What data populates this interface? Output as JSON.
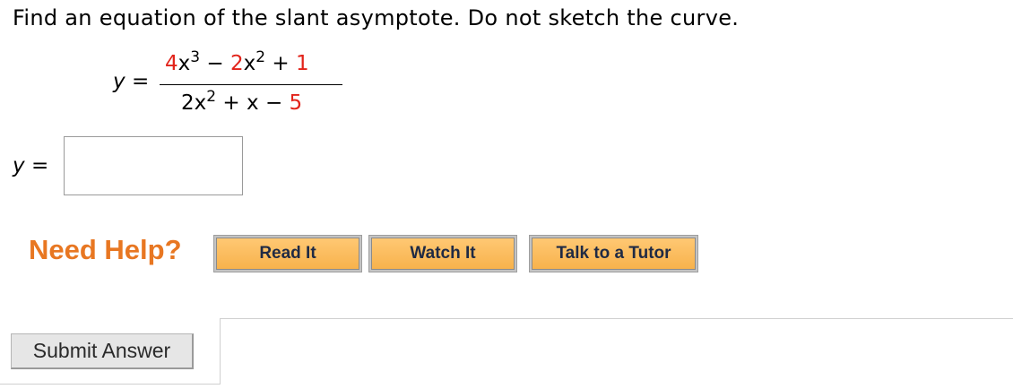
{
  "question": {
    "text": "Find an equation of the slant asymptote. Do not sketch the curve."
  },
  "equation": {
    "lhs_var": "y",
    "equals": "=",
    "numerator": {
      "term1_coef": "4",
      "term1_var": "x",
      "term1_exp": "3",
      "op1": "−",
      "term2_coef": "2",
      "term2_var": "x",
      "term2_exp": "2",
      "op2": "+",
      "term3": "1"
    },
    "denominator": {
      "term1_coef": "2",
      "term1_var": "x",
      "term1_exp": "2",
      "op1": "+",
      "term2": "x",
      "op2": "−",
      "term3": "5"
    }
  },
  "answer": {
    "label_var": "y",
    "label_equals": "=",
    "value": "",
    "placeholder": ""
  },
  "help": {
    "label": "Need Help?",
    "buttons": [
      "Read It",
      "Watch It",
      "Talk to a Tutor"
    ]
  },
  "submit": {
    "label": "Submit Answer"
  },
  "colors": {
    "accent_red": "#e2231a",
    "need_help_orange": "#e87722",
    "help_button_fill": "#f7b24c"
  }
}
